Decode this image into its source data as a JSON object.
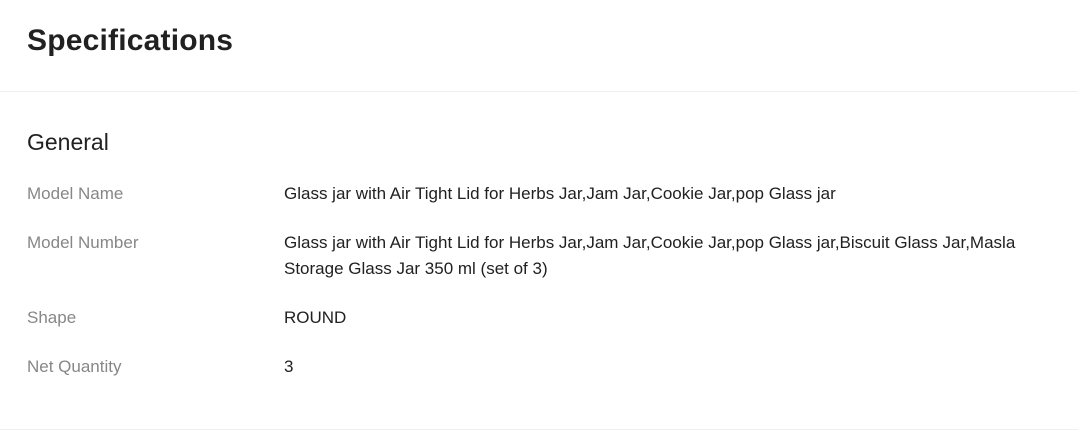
{
  "header": {
    "title": "Specifications"
  },
  "section": {
    "title": "General",
    "rows": [
      {
        "key": "Model Name",
        "value": "Glass jar with Air Tight Lid for Herbs Jar,Jam Jar,Cookie Jar,pop Glass jar"
      },
      {
        "key": "Model Number",
        "value": "Glass jar with Air Tight Lid for Herbs Jar,Jam Jar,Cookie Jar,pop Glass jar,Biscuit Glass Jar,Masla Storage Glass Jar 350 ml (set of 3)"
      },
      {
        "key": "Shape",
        "value": "ROUND"
      },
      {
        "key": "Net Quantity",
        "value": "3"
      }
    ]
  }
}
